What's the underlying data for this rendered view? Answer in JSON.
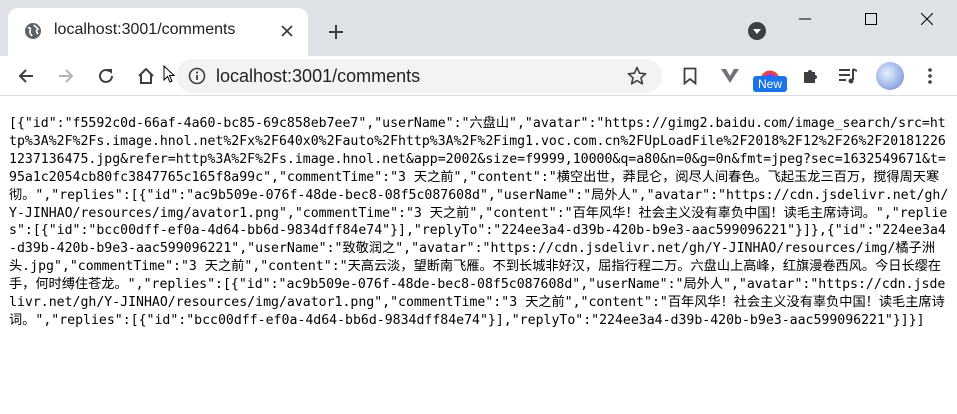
{
  "tab": {
    "title": "localhost:3001/comments"
  },
  "omnibox": {
    "url": "localhost:3001/comments"
  },
  "extensions": {
    "new_badge": "New"
  },
  "icons": {
    "favicon": "globe-icon",
    "close": "close-icon",
    "new_tab": "plus-icon",
    "tab_search": "chevron-down-icon",
    "back": "arrow-left-icon",
    "forward": "arrow-right-icon",
    "reload": "reload-icon",
    "home": "home-icon",
    "info": "info-icon",
    "star": "star-icon",
    "bookmark": "bookmark-icon",
    "extension_v": "v-extension-icon",
    "extension_color": "color-extension-icon",
    "extensions_menu": "puzzle-icon",
    "media": "media-control-icon",
    "profile": "avatar",
    "menu": "kebab-menu-icon"
  },
  "colors": {
    "tabstrip": "#dee1e6",
    "omnibox": "#f1f3f4",
    "badge": "#1a73e8"
  },
  "content": {
    "json_text": "[{\"id\":\"f5592c0d-66af-4a60-bc85-69c858eb7ee7\",\"userName\":\"六盘山\",\"avatar\":\"https://gimg2.baidu.com/image_search/src=http%3A%2F%2Fs.image.hnol.net%2Fx%2F640x0%2Fauto%2Fhttp%3A%2F%2Fimg1.voc.com.cn%2FUpLoadFile%2F2018%2F12%2F26%2F201812261237136475.jpg&refer=http%3A%2F%2Fs.image.hnol.net&app=2002&size=f9999,10000&q=a80&n=0&g=0n&fmt=jpeg?sec=1632549671&t=95a1c2054cb80fc3847765c165f8a99c\",\"commentTime\":\"3 天之前\",\"content\":\"横空出世，莽昆仑，阅尽人间春色。飞起玉龙三百万，搅得周天寒彻。\",\"replies\":[{\"id\":\"ac9b509e-076f-48de-bec8-08f5c087608d\",\"userName\":\"局外人\",\"avatar\":\"https://cdn.jsdelivr.net/gh/Y-JINHAO/resources/img/avator1.png\",\"commentTime\":\"3 天之前\",\"content\":\"百年风华！社会主义没有辜负中国！读毛主席诗词。\",\"replies\":[{\"id\":\"bcc00dff-ef0a-4d64-bb6d-9834dff84e74\"}],\"replyTo\":\"224ee3a4-d39b-420b-b9e3-aac599096221\"}]},{\"id\":\"224ee3a4-d39b-420b-b9e3-aac599096221\",\"userName\":\"致敬润之\",\"avatar\":\"https://cdn.jsdelivr.net/gh/Y-JINHAO/resources/img/橘子洲头.jpg\",\"commentTime\":\"3 天之前\",\"content\":\"天高云淡，望断南飞雁。不到长城非好汉，屈指行程二万。六盘山上高峰，红旗漫卷西风。今日长缨在手，何时缚住苍龙。\",\"replies\":[{\"id\":\"ac9b509e-076f-48de-bec8-08f5c087608d\",\"userName\":\"局外人\",\"avatar\":\"https://cdn.jsdelivr.net/gh/Y-JINHAO/resources/img/avator1.png\",\"commentTime\":\"3 天之前\",\"content\":\"百年风华！社会主义没有辜负中国！读毛主席诗词。\",\"replies\":[{\"id\":\"bcc00dff-ef0a-4d64-bb6d-9834dff84e74\"}],\"replyTo\":\"224ee3a4-d39b-420b-b9e3-aac599096221\"}]}]"
  }
}
